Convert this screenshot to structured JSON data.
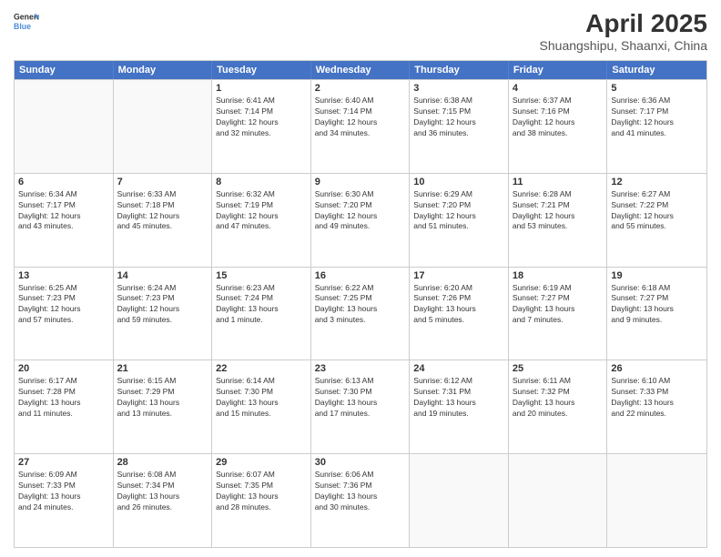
{
  "header": {
    "logo_line1": "General",
    "logo_line2": "Blue",
    "month_year": "April 2025",
    "location": "Shuangshipu, Shaanxi, China"
  },
  "days_of_week": [
    "Sunday",
    "Monday",
    "Tuesday",
    "Wednesday",
    "Thursday",
    "Friday",
    "Saturday"
  ],
  "weeks": [
    [
      {
        "day": "",
        "info": ""
      },
      {
        "day": "",
        "info": ""
      },
      {
        "day": "1",
        "info": "Sunrise: 6:41 AM\nSunset: 7:14 PM\nDaylight: 12 hours\nand 32 minutes."
      },
      {
        "day": "2",
        "info": "Sunrise: 6:40 AM\nSunset: 7:14 PM\nDaylight: 12 hours\nand 34 minutes."
      },
      {
        "day": "3",
        "info": "Sunrise: 6:38 AM\nSunset: 7:15 PM\nDaylight: 12 hours\nand 36 minutes."
      },
      {
        "day": "4",
        "info": "Sunrise: 6:37 AM\nSunset: 7:16 PM\nDaylight: 12 hours\nand 38 minutes."
      },
      {
        "day": "5",
        "info": "Sunrise: 6:36 AM\nSunset: 7:17 PM\nDaylight: 12 hours\nand 41 minutes."
      }
    ],
    [
      {
        "day": "6",
        "info": "Sunrise: 6:34 AM\nSunset: 7:17 PM\nDaylight: 12 hours\nand 43 minutes."
      },
      {
        "day": "7",
        "info": "Sunrise: 6:33 AM\nSunset: 7:18 PM\nDaylight: 12 hours\nand 45 minutes."
      },
      {
        "day": "8",
        "info": "Sunrise: 6:32 AM\nSunset: 7:19 PM\nDaylight: 12 hours\nand 47 minutes."
      },
      {
        "day": "9",
        "info": "Sunrise: 6:30 AM\nSunset: 7:20 PM\nDaylight: 12 hours\nand 49 minutes."
      },
      {
        "day": "10",
        "info": "Sunrise: 6:29 AM\nSunset: 7:20 PM\nDaylight: 12 hours\nand 51 minutes."
      },
      {
        "day": "11",
        "info": "Sunrise: 6:28 AM\nSunset: 7:21 PM\nDaylight: 12 hours\nand 53 minutes."
      },
      {
        "day": "12",
        "info": "Sunrise: 6:27 AM\nSunset: 7:22 PM\nDaylight: 12 hours\nand 55 minutes."
      }
    ],
    [
      {
        "day": "13",
        "info": "Sunrise: 6:25 AM\nSunset: 7:23 PM\nDaylight: 12 hours\nand 57 minutes."
      },
      {
        "day": "14",
        "info": "Sunrise: 6:24 AM\nSunset: 7:23 PM\nDaylight: 12 hours\nand 59 minutes."
      },
      {
        "day": "15",
        "info": "Sunrise: 6:23 AM\nSunset: 7:24 PM\nDaylight: 13 hours\nand 1 minute."
      },
      {
        "day": "16",
        "info": "Sunrise: 6:22 AM\nSunset: 7:25 PM\nDaylight: 13 hours\nand 3 minutes."
      },
      {
        "day": "17",
        "info": "Sunrise: 6:20 AM\nSunset: 7:26 PM\nDaylight: 13 hours\nand 5 minutes."
      },
      {
        "day": "18",
        "info": "Sunrise: 6:19 AM\nSunset: 7:27 PM\nDaylight: 13 hours\nand 7 minutes."
      },
      {
        "day": "19",
        "info": "Sunrise: 6:18 AM\nSunset: 7:27 PM\nDaylight: 13 hours\nand 9 minutes."
      }
    ],
    [
      {
        "day": "20",
        "info": "Sunrise: 6:17 AM\nSunset: 7:28 PM\nDaylight: 13 hours\nand 11 minutes."
      },
      {
        "day": "21",
        "info": "Sunrise: 6:15 AM\nSunset: 7:29 PM\nDaylight: 13 hours\nand 13 minutes."
      },
      {
        "day": "22",
        "info": "Sunrise: 6:14 AM\nSunset: 7:30 PM\nDaylight: 13 hours\nand 15 minutes."
      },
      {
        "day": "23",
        "info": "Sunrise: 6:13 AM\nSunset: 7:30 PM\nDaylight: 13 hours\nand 17 minutes."
      },
      {
        "day": "24",
        "info": "Sunrise: 6:12 AM\nSunset: 7:31 PM\nDaylight: 13 hours\nand 19 minutes."
      },
      {
        "day": "25",
        "info": "Sunrise: 6:11 AM\nSunset: 7:32 PM\nDaylight: 13 hours\nand 20 minutes."
      },
      {
        "day": "26",
        "info": "Sunrise: 6:10 AM\nSunset: 7:33 PM\nDaylight: 13 hours\nand 22 minutes."
      }
    ],
    [
      {
        "day": "27",
        "info": "Sunrise: 6:09 AM\nSunset: 7:33 PM\nDaylight: 13 hours\nand 24 minutes."
      },
      {
        "day": "28",
        "info": "Sunrise: 6:08 AM\nSunset: 7:34 PM\nDaylight: 13 hours\nand 26 minutes."
      },
      {
        "day": "29",
        "info": "Sunrise: 6:07 AM\nSunset: 7:35 PM\nDaylight: 13 hours\nand 28 minutes."
      },
      {
        "day": "30",
        "info": "Sunrise: 6:06 AM\nSunset: 7:36 PM\nDaylight: 13 hours\nand 30 minutes."
      },
      {
        "day": "",
        "info": ""
      },
      {
        "day": "",
        "info": ""
      },
      {
        "day": "",
        "info": ""
      }
    ]
  ]
}
